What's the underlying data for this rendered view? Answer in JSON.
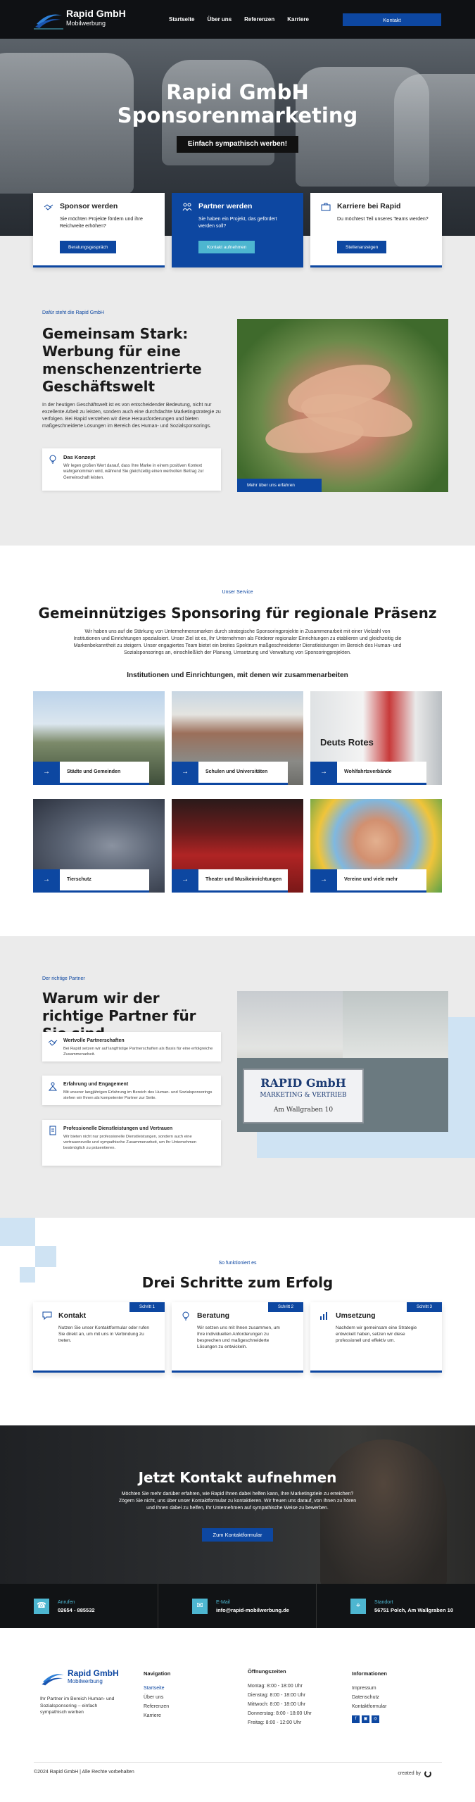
{
  "header": {
    "logo_line1": "Rapid GmbH",
    "logo_line2": "Mobilwerbung",
    "nav": [
      "Startseite",
      "Über uns",
      "Referenzen",
      "Karriere"
    ],
    "cta": "Kontakt"
  },
  "hero": {
    "title_line1": "Rapid GmbH",
    "title_line2": "Sponsorenmarketing",
    "tagline": "Einfach sympathisch werben!"
  },
  "feature_cards": [
    {
      "title": "Sponsor werden",
      "text": "Sie möchten Projekte fördern und ihre Reichweite erhöhen?",
      "button": "Beratungsgespräch",
      "icon": "handshake-icon"
    },
    {
      "title": "Partner werden",
      "text": "Sie haben ein Projekt, das gefördert werden soll?",
      "button": "Kontakt aufnehmen",
      "icon": "partners-icon"
    },
    {
      "title": "Karriere bei Rapid",
      "text": "Du möchtest Teil unseres Teams werden?",
      "button": "Stellenanzeigen",
      "icon": "briefcase-icon"
    }
  ],
  "about": {
    "kicker": "Dafür steht die Rapid GmbH",
    "title": "Gemeinsam Stark: Werbung für eine menschenzentrierte Geschäftswelt",
    "body": "In der heutigen Geschäftswelt ist es von entscheidender Bedeutung, nicht nur exzellente Arbeit zu leisten, sondern auch eine durchdachte Marketingstrategie zu verfolgen. Bei Rapid verstehen wir diese Herausforderungen und bieten maßgeschneiderte Lösungen im Bereich des Human- und Sozialsponsorings.",
    "concept_title": "Das Konzept",
    "concept_text": "Wir legen großen Wert darauf, dass Ihre Marke in einem positiven Kontext wahrgenommen wird, während Sie gleichzeitig einen wertvollen Beitrag zur Gemeinschaft leisten.",
    "image_button": "Mehr über uns erfahren"
  },
  "services": {
    "kicker": "Unser Service",
    "title": "Gemeinnütziges Sponsoring für regionale Präsenz",
    "intro": "Wir haben uns auf die Stärkung von Unternehmensmarken durch strategische Sponsoringprojekte in Zusammenarbeit mit einer Vielzahl von Institutionen und Einrichtungen spezialisiert. Unser Ziel ist es, Ihr Unternehmen als Förderer regionaler Einrichtungen zu etablieren und gleichzeitig die Markenbekanntheit zu steigern. Unser engagiertes Team bietet ein breites Spektrum maßgeschneiderter Dienstleistungen im Bereich des Human- und Sozialsponsorings an, einschließlich der Planung, Umsetzung und Verwaltung von Sponsoringprojekten.",
    "subtitle": "Institutionen und Einrichtungen, mit denen wir zusammenarbeiten",
    "tiles": [
      "Städte und Gemeinden",
      "Schulen und Universitäten",
      "Wohlfahrtsverbände",
      "Tierschutz",
      "Theater und Musikeinrichtungen",
      "Vereine und viele mehr"
    ],
    "tile3_sign": "Deuts Rotes"
  },
  "partner": {
    "kicker": "Der richtige Partner",
    "title": "Warum wir der richtige Partner für Sie sind",
    "items": [
      {
        "title": "Wertvolle Partnerschaften",
        "text": "Bei Rapid setzen wir auf langfristige Partnerschaften als Basis für eine erfolgreiche Zusammenarbeit."
      },
      {
        "title": "Erfahrung und Engagement",
        "text": "Mit unserer langjährigen Erfahrung im Bereich des Human- und Sozialsponsorings stehen wir Ihnen als kompetenter Partner zur Seite."
      },
      {
        "title": "Professionelle Dienstleistungen und Vertrauen",
        "text": "Wir bieten nicht nur professionelle Dienstleistungen, sondern auch eine vertrauensvolle und sympathische Zusammenarbeit, um Ihr Unternehmen bestmöglich zu präsentieren."
      }
    ],
    "sign_line1": "RAPID GmbH",
    "sign_line2": "MARKETING & VERTRIEB",
    "sign_line3": "Am Wallgraben 10"
  },
  "steps": {
    "kicker": "So funktioniert es",
    "title": "Drei Schritte zum Erfolg",
    "items": [
      {
        "badge": "Schritt 1",
        "title": "Kontakt",
        "text": "Nutzen Sie unser Kontaktformular oder rufen Sie direkt an, um mit uns in Verbindung zu treten."
      },
      {
        "badge": "Schritt 2",
        "title": "Beratung",
        "text": "Wir setzen uns mit Ihnen zusammen, um Ihre individuellen Anforderungen zu besprechen und maßgeschneiderte Lösungen zu entwickeln."
      },
      {
        "badge": "Schritt 3",
        "title": "Umsetzung",
        "text": "Nachdem wir gemeinsam eine Strategie entwickelt haben, setzen wir diese professionell und effektiv um."
      }
    ]
  },
  "contact": {
    "title": "Jetzt Kontakt aufnehmen",
    "text": "Möchten Sie mehr darüber erfahren, wie Rapid Ihnen dabei helfen kann, Ihre Marketingziele zu erreichen? Zögern Sie nicht, uns über unser Kontaktformular zu kontaktieren. Wir freuen uns darauf, von Ihnen zu hören und Ihnen dabei zu helfen, Ihr Unternehmen auf sympathische Weise zu bewerben.",
    "button": "Zum Kontaktformular"
  },
  "infobar": [
    {
      "label": "Anrufen",
      "value": "02654 - 885532",
      "icon": "phone-icon"
    },
    {
      "label": "E-Mail",
      "value": "info@rapid-mobilwerbung.de",
      "icon": "mail-icon"
    },
    {
      "label": "Standort",
      "value": "56751 Polch, Am Wallgraben 10",
      "icon": "location-icon"
    }
  ],
  "footer": {
    "about": "Ihr Partner im Bereich Human- und Sozialsponsoring – einfach sympathisch werben",
    "nav_title": "Navigation",
    "nav": [
      "Startseite",
      "Über uns",
      "Referenzen",
      "Karriere"
    ],
    "hours_title": "Öffnungszeiten",
    "hours": [
      "Montag: 8:00 - 18:00 Uhr",
      "Dienstag: 8:00 - 18:00 Uhr",
      "Mittwoch: 8:00 - 18:00 Uhr",
      "Donnerstag: 8:00 - 18:00 Uhr",
      "Freitag: 8:00 - 12:00 Uhr"
    ],
    "info_title": "Informationen",
    "info": [
      "Impressum",
      "Datenschutz",
      "Kontaktformular"
    ],
    "copyright": "©2024 Rapid GmbH | Alle Rechte vorbehalten",
    "created_by": "created by"
  },
  "colors": {
    "brand": "#0d47a1",
    "accent": "#4db6d0",
    "dark": "#111315",
    "light_bg": "#ebebeb"
  }
}
